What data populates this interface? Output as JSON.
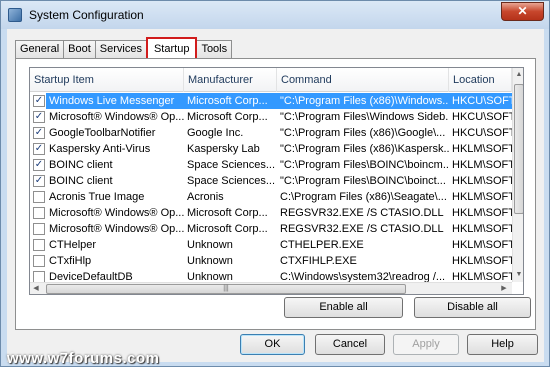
{
  "window": {
    "title": "System Configuration",
    "close_label": "✕"
  },
  "tabs": [
    {
      "label": "General"
    },
    {
      "label": "Boot"
    },
    {
      "label": "Services"
    },
    {
      "label": "Startup",
      "active": true
    },
    {
      "label": "Tools"
    }
  ],
  "table": {
    "columns": [
      "Startup Item",
      "Manufacturer",
      "Command",
      "Location"
    ],
    "rows": [
      {
        "checked": true,
        "selected": true,
        "item": "Windows Live Messenger",
        "manufacturer": "Microsoft Corp...",
        "command": "\"C:\\Program Files (x86)\\Windows...",
        "location": "HKCU\\SOFTW"
      },
      {
        "checked": true,
        "item": "Microsoft® Windows® Op...",
        "manufacturer": "Microsoft Corp...",
        "command": "\"C:\\Program Files\\Windows Sideb...",
        "location": "HKCU\\SOFTW"
      },
      {
        "checked": true,
        "item": "GoogleToolbarNotifier",
        "manufacturer": "Google Inc.",
        "command": "\"C:\\Program Files (x86)\\Google\\...",
        "location": "HKCU\\SOFTW"
      },
      {
        "checked": true,
        "item": "Kaspersky Anti-Virus",
        "manufacturer": "Kaspersky Lab",
        "command": "\"C:\\Program Files (x86)\\Kaspersk...",
        "location": "HKLM\\SOFTW"
      },
      {
        "checked": true,
        "item": "BOINC client",
        "manufacturer": "Space Sciences...",
        "command": "\"C:\\Program Files\\BOINC\\boincm...",
        "location": "HKLM\\SOFTW"
      },
      {
        "checked": true,
        "item": "BOINC client",
        "manufacturer": "Space Sciences...",
        "command": "\"C:\\Program Files\\BOINC\\boinct...",
        "location": "HKLM\\SOFTW"
      },
      {
        "checked": false,
        "item": "Acronis True Image",
        "manufacturer": "Acronis",
        "command": "C:\\Program Files (x86)\\Seagate\\...",
        "location": "HKLM\\SOFTW"
      },
      {
        "checked": false,
        "item": "Microsoft® Windows® Op...",
        "manufacturer": "Microsoft Corp...",
        "command": "REGSVR32.EXE /S CTASIO.DLL",
        "location": "HKLM\\SOFTW"
      },
      {
        "checked": false,
        "item": "Microsoft® Windows® Op...",
        "manufacturer": "Microsoft Corp...",
        "command": "REGSVR32.EXE /S CTASIO.DLL",
        "location": "HKLM\\SOFTW"
      },
      {
        "checked": false,
        "item": "CTHelper",
        "manufacturer": "Unknown",
        "command": "CTHELPER.EXE",
        "location": "HKLM\\SOFTW"
      },
      {
        "checked": false,
        "item": "CTxfiHlp",
        "manufacturer": "Unknown",
        "command": "CTXFIHLP.EXE",
        "location": "HKLM\\SOFTW"
      },
      {
        "checked": false,
        "item": "DeviceDefaultDB",
        "manufacturer": "Unknown",
        "command": "C:\\Windows\\system32\\readrog /...",
        "location": "HKLM\\SOFTW"
      }
    ]
  },
  "buttons": {
    "enable_all": "Enable all",
    "disable_all": "Disable all",
    "ok": "OK",
    "cancel": "Cancel",
    "apply": "Apply",
    "help": "Help"
  },
  "watermark": "www.w7forums.com",
  "icons": {
    "window": "msconfig-icon",
    "close": "close-icon",
    "scroll_up": "scroll-up-arrow",
    "scroll_down": "scroll-down-arrow",
    "scroll_left": "scroll-left-arrow",
    "scroll_right": "scroll-right-arrow"
  },
  "colors": {
    "selection": "#3399ff",
    "highlight_tab_border": "#d11c1c",
    "close_button": "#c7462c"
  }
}
